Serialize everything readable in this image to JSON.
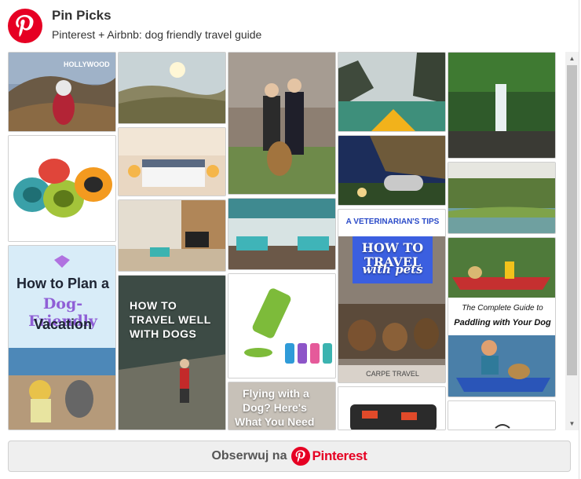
{
  "header": {
    "title": "Pin Picks",
    "subtitle": "Pinterest + Airbnb: dog friendly travel guide",
    "logo_icon": "pinterest-logo-icon"
  },
  "pins": {
    "plan_vacation": {
      "line1": "How to Plan a",
      "line2": "Dog-Friendly",
      "line3": "Vacation"
    },
    "travel_well": {
      "line1": "HOW TO",
      "line2": "TRAVEL WELL",
      "line3": "WITH DOGS"
    },
    "flying": {
      "line1": "Flying with a",
      "line2": "Dog? Here's",
      "line3": "What You Need"
    },
    "vet_tips": {
      "banner": "A VETERINARIAN'S TIPS",
      "headline": "HOW TO TRAVEL",
      "script": "with pets",
      "footer": "CARPE TRAVEL"
    },
    "paddling": {
      "line1": "The Complete Guide to",
      "line2": "Paddling with Your Dog"
    }
  },
  "follow_button": {
    "label": "Obserwuj na",
    "brand": "Pinterest"
  },
  "colors": {
    "pinterest_red": "#e60023",
    "button_bg": "#efefef",
    "purple_accent": "#8f5fd6"
  }
}
